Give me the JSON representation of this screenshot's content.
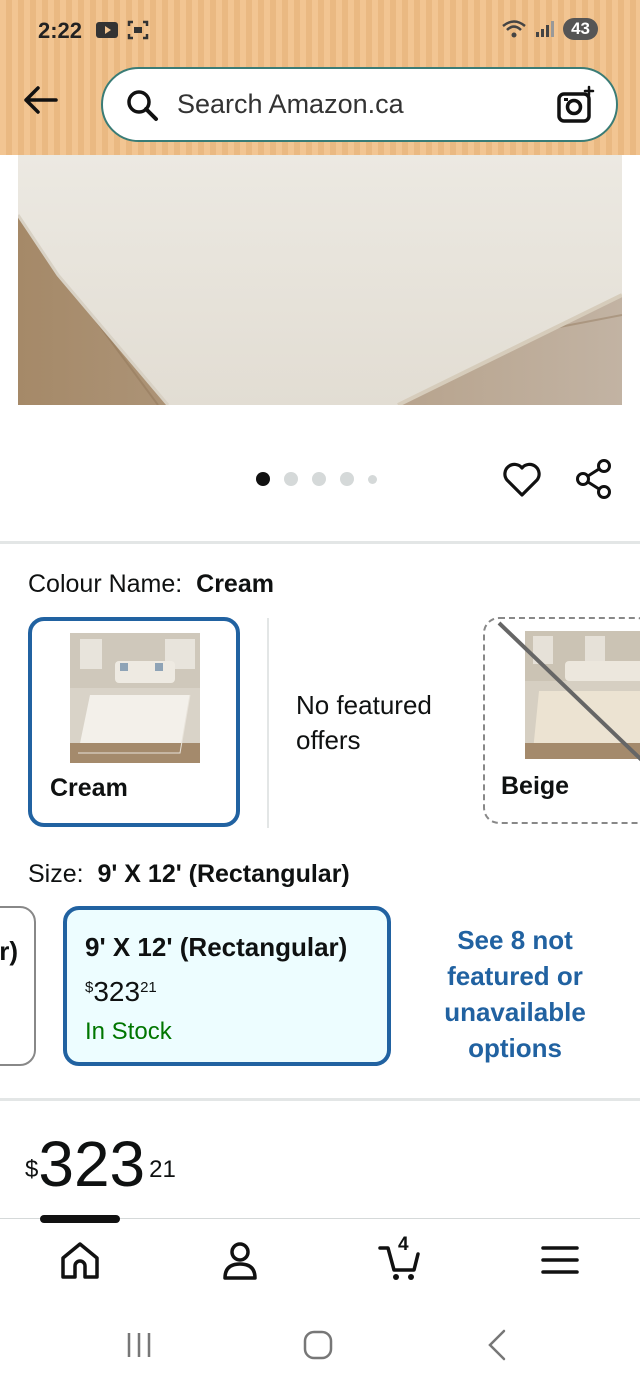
{
  "status_bar": {
    "time": "2:22",
    "battery": "43"
  },
  "search": {
    "placeholder": "Search Amazon.ca"
  },
  "gallery": {
    "dots_count": 5,
    "active_dot": 0
  },
  "colour": {
    "label": "Colour Name:",
    "selected": "Cream",
    "options": [
      {
        "label": "Cream",
        "selected": true
      },
      {
        "label": "No featured offers"
      },
      {
        "label": "Beige",
        "unavailable": true
      }
    ],
    "no_featured_line1": "No featured",
    "no_featured_line2": "offers"
  },
  "size": {
    "label": "Size:",
    "selected": "9' X 12' (Rectangular)",
    "left_partial": "r)",
    "option_title": "9' X 12' (Rectangular)",
    "option_price_currency": "$",
    "option_price_whole": "323",
    "option_price_cents": "21",
    "option_stock": "In Stock",
    "see_more_lines": [
      "See 8 not",
      "featured or",
      "unavailable",
      "options"
    ]
  },
  "price": {
    "currency": "$",
    "whole": "323",
    "cents": "21"
  },
  "bottom_nav": {
    "items": [
      "home-icon",
      "account-icon",
      "cart-icon",
      "menu-icon"
    ],
    "cart_count": "4"
  },
  "colors": {
    "accent_blue": "#2162a1",
    "header_bg": "#f2c592",
    "stock_green": "#007600"
  }
}
